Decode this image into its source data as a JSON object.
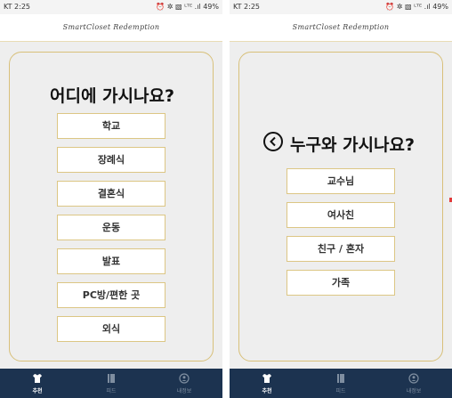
{
  "left_screen": {
    "status": {
      "carrier_time": "KT 2:25",
      "icons_right": "⏰ ✲ ▧ ᴸᵀᴱ .ıl 49%"
    },
    "app_title": "SmartCloset Redemption",
    "question": "어디에 가시나요?",
    "options": [
      "학교",
      "장례식",
      "결혼식",
      "운동",
      "발표",
      "PC방/편한 곳",
      "외식"
    ],
    "nav": [
      {
        "label": "추천",
        "icon": "shirt-icon"
      },
      {
        "label": "피드",
        "icon": "book-icon"
      },
      {
        "label": "내정보",
        "icon": "user-icon"
      }
    ]
  },
  "right_screen": {
    "status": {
      "carrier_time": "KT 2:25",
      "icons_right": "⏰ ✲ ▧ ᴸᵀᴱ .ıl 49%"
    },
    "app_title": "SmartCloset Redemption",
    "question": "누구와 가시나요?",
    "back_icon": "back-circle-icon",
    "options": [
      "교수님",
      "여사친",
      "친구 / 혼자",
      "가족"
    ],
    "nav": [
      {
        "label": "추천",
        "icon": "shirt-icon"
      },
      {
        "label": "피드",
        "icon": "book-icon"
      },
      {
        "label": "내정보",
        "icon": "user-icon"
      }
    ]
  },
  "colors": {
    "nav_bg": "#1c3350",
    "accent_border": "#d8c07a",
    "card_bg": "#eeeeee"
  }
}
